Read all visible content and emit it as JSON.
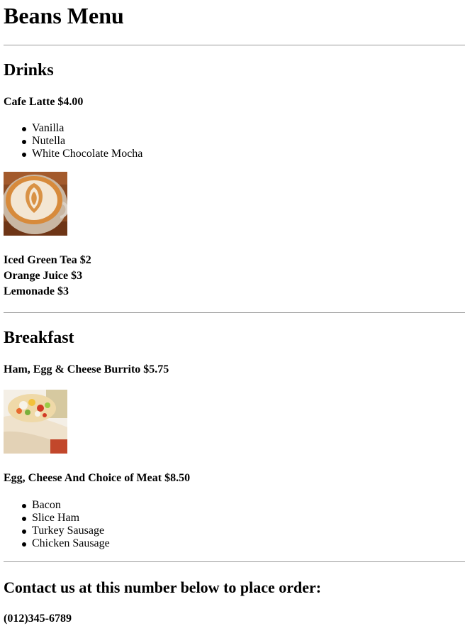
{
  "title": "Beans Menu",
  "drinks": {
    "heading": "Drinks",
    "latte": {
      "name": "Cafe Latte $4.00",
      "flavors": [
        "Vanilla",
        "Nutella",
        "White Chocolate Mocha"
      ]
    },
    "others": [
      "Iced Green Tea $2",
      "Orange Juice $3",
      "Lemonade $3"
    ]
  },
  "breakfast": {
    "heading": "Breakfast",
    "burrito": {
      "name": "Ham, Egg & Cheese Burrito $5.75"
    },
    "egg_cheese": {
      "name": "Egg, Cheese And Choice of Meat $8.50",
      "meats": [
        "Bacon",
        "Slice Ham",
        "Turkey Sausage",
        "Chicken Sausage"
      ]
    }
  },
  "contact": {
    "heading": "Contact us at this number below to place order:",
    "phone": "(012)345-6789"
  }
}
